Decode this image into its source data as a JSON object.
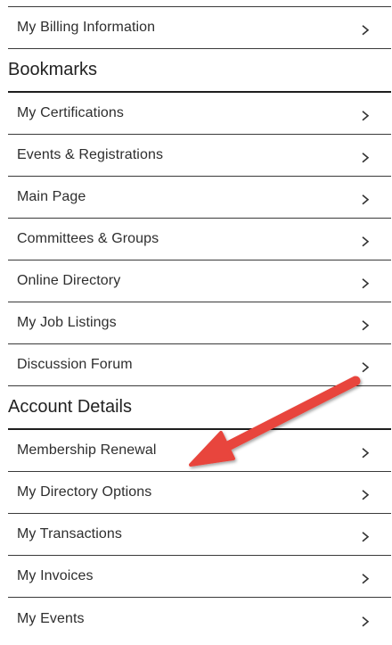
{
  "sections": [
    {
      "title": "",
      "items": [
        {
          "label": "My Billing Information"
        }
      ]
    },
    {
      "title": "Bookmarks",
      "items": [
        {
          "label": "My Certifications"
        },
        {
          "label": "Events & Registrations"
        },
        {
          "label": "Main Page"
        },
        {
          "label": "Committees & Groups"
        },
        {
          "label": "Online Directory"
        },
        {
          "label": "My Job Listings"
        },
        {
          "label": "Discussion Forum"
        }
      ]
    },
    {
      "title": "Account Details",
      "items": [
        {
          "label": "Membership Renewal"
        },
        {
          "label": "My Directory Options"
        },
        {
          "label": "My Transactions"
        },
        {
          "label": "My Invoices"
        },
        {
          "label": "My Events"
        }
      ]
    }
  ],
  "annotation": {
    "icon": "red-arrow-icon",
    "color": "#e8453c",
    "points_to": "Membership Renewal"
  },
  "colors": {
    "text": "#2e2e2e",
    "rule": "#3a3a3a",
    "arrow": "#e8453c"
  }
}
